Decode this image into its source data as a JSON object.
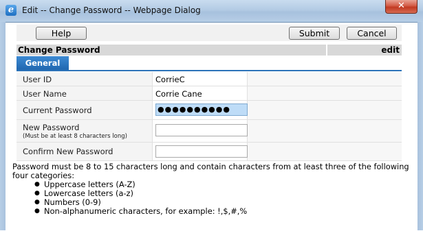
{
  "window": {
    "title": "Edit -- Change Password -- Webpage Dialog",
    "icon": "ie-icon",
    "close_label": "✕"
  },
  "toolbar": {
    "help_label": "Help",
    "submit_label": "Submit",
    "cancel_label": "Cancel"
  },
  "header": {
    "title": "Change Password",
    "mode": "edit"
  },
  "tabs": [
    {
      "label": "General",
      "active": true
    }
  ],
  "form": {
    "user_id": {
      "label": "User ID",
      "value": "CorrieC"
    },
    "user_name": {
      "label": "User Name",
      "value": "Corrie Cane"
    },
    "current_password": {
      "label": "Current Password",
      "value": "●●●●●●●●●●"
    },
    "new_password": {
      "label": "New Password",
      "hint": "(Must be at least 8 characters long)",
      "value": ""
    },
    "confirm_password": {
      "label": "Confirm New Password",
      "value": ""
    }
  },
  "requirements": {
    "intro": "Password must be 8 to 15 characters long and contain characters from at least three of the following four categories:",
    "items": [
      "Uppercase letters (A-Z)",
      "Lowercase letters (a-z)",
      "Numbers (0-9)",
      "Non-alphanumeric characters, for example: !,$,#,%"
    ]
  },
  "colors": {
    "tab_active": "#2a76c0",
    "focus_field": "#bedcf7",
    "header_bar": "#d8d8d8"
  }
}
